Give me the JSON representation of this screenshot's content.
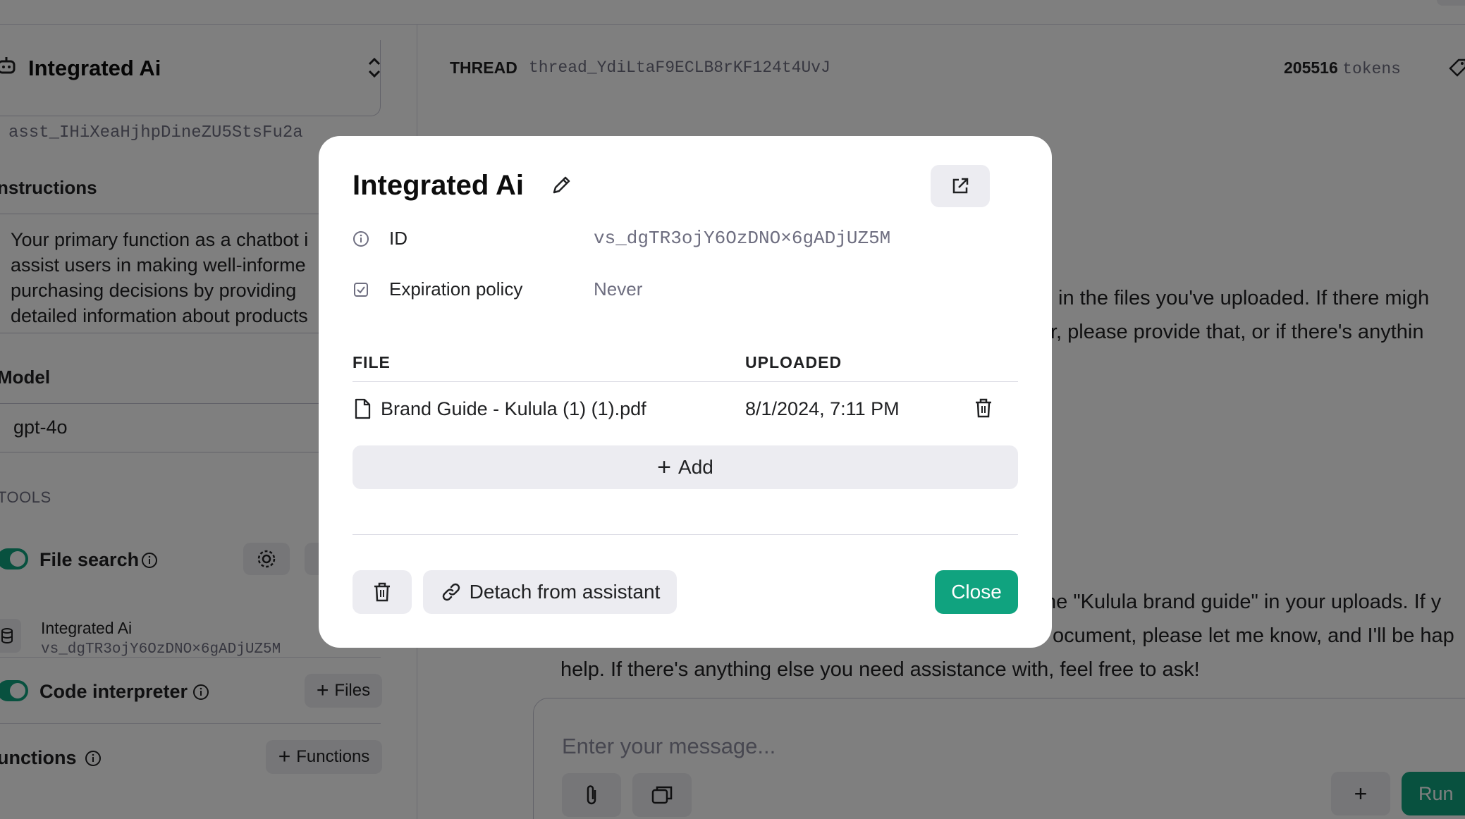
{
  "sidebar": {
    "assistant_name": "Integrated Ai",
    "assistant_id": "asst_IHiXeaHjhpDineZU5StsFu2a",
    "instructions_label": "nstructions",
    "instructions_lines": [
      "Your primary function as a chatbot i",
      "assist users in making well-informe",
      "purchasing decisions by providing",
      "detailed information about products"
    ],
    "model_label": "Model",
    "model_value": "gpt-4o",
    "tools_label": "TOOLS",
    "file_search_label": "File search",
    "vector_store_name": "Integrated Ai",
    "vector_store_id": "vs_dgTR3ojY6OzDNO×6gADjUZ5M",
    "code_interpreter_label": "Code interpreter",
    "files_button": "Files",
    "functions_label": "unctions",
    "functions_button": "Functions"
  },
  "thread": {
    "label": "THREAD",
    "id": "thread_YdiLtaF9ECLB8rKF124t4UvJ",
    "token_count": "205516",
    "token_unit": "tokens",
    "message_lines": [
      "in the files you've uploaded. If there migh",
      "r, please provide that, or if there's anythin",
      "ne \"Kulula brand guide\" in your uploads. If y",
      "ocument, please let me know, and I'll be hap",
      "help. If there's anything else you need assistance with, feel free to ask!"
    ],
    "composer_placeholder": "Enter your message...",
    "run_button": "Run"
  },
  "modal": {
    "title": "Integrated Ai",
    "id_label": "ID",
    "id_value": "vs_dgTR3ojY6OzDNO×6gADjUZ5M",
    "expiration_label": "Expiration policy",
    "expiration_value": "Never",
    "table_headers": {
      "file": "FILE",
      "uploaded": "UPLOADED"
    },
    "files": [
      {
        "name": "Brand Guide - Kulula (1) (1).pdf",
        "uploaded": "8/1/2024, 7:11 PM"
      }
    ],
    "add_button": "Add",
    "detach_button": "Detach from assistant",
    "close_button": "Close"
  },
  "colors": {
    "accent": "#10a37f",
    "overlay": "rgba(0,0,0,0.5)",
    "button_bg": "#ececf1"
  },
  "icons": [
    "robot-icon",
    "chevron-updown-icon",
    "info-icon",
    "gear-icon",
    "database-icon",
    "plus-icon",
    "tag-icon",
    "paperclip-icon",
    "images-icon",
    "pencil-icon",
    "external-link-icon",
    "checkbox-icon",
    "file-icon",
    "trash-icon",
    "link-icon"
  ]
}
